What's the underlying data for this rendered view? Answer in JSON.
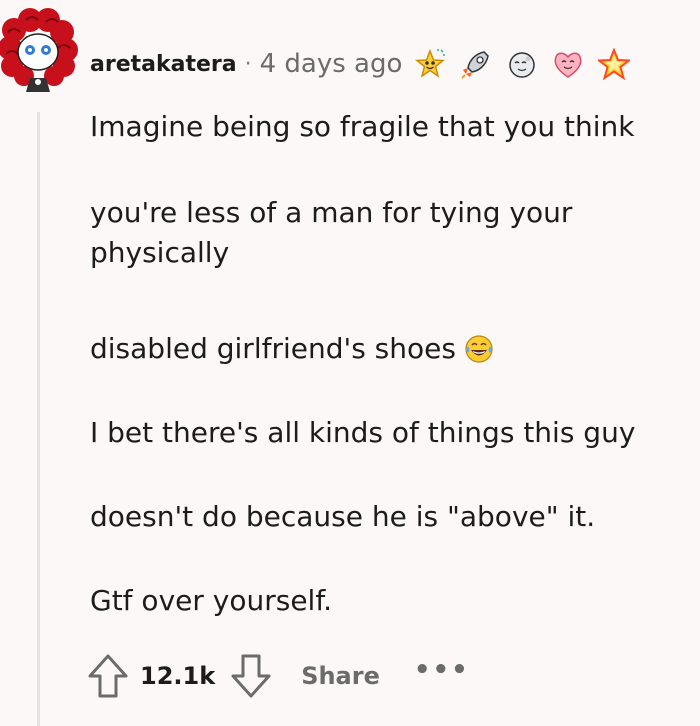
{
  "comment": {
    "username": "aretakatera",
    "separator": "·",
    "timestamp": "4 days ago",
    "awards": [
      "star-struck-award-icon",
      "rocket-award-icon",
      "moon-face-award-icon",
      "heart-eyes-award-icon",
      "star-award-icon"
    ],
    "paragraphs": [
      "Imagine being so fragile that you think",
      "you're less of a man for tying your",
      "physically",
      "disabled girlfriend's shoes",
      "I bet there's all kinds of things this guy",
      "doesn't do because he is \"above\" it.",
      "Gtf over yourself."
    ],
    "emoji": "laughing-tears-emoji"
  },
  "actions": {
    "score": "12.1k",
    "share_label": "Share",
    "more_label": "•••"
  },
  "colors": {
    "background": "#fbf8f7",
    "text": "#1c1c1c",
    "muted": "#6b6b6b",
    "avatar_hair": "#c8101c"
  }
}
